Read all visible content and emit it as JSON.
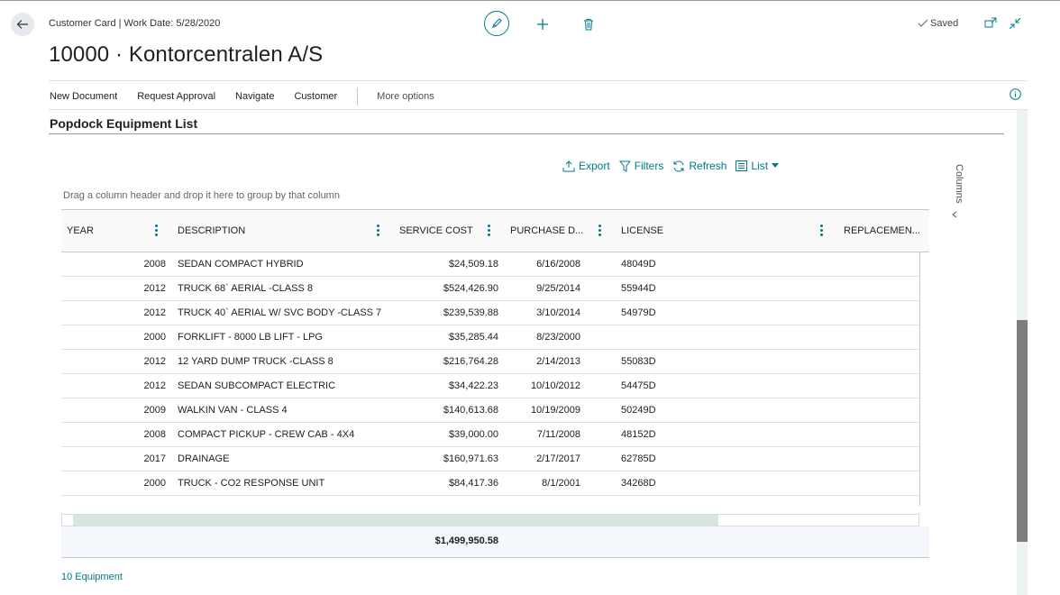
{
  "header": {
    "caption": "Customer Card | Work Date: 5/28/2020",
    "title": "10000 · Kontorcentralen A/S",
    "saved_label": "Saved",
    "icons": {
      "back": "arrow-left-icon",
      "edit": "pencil-icon",
      "new": "plus-icon",
      "delete": "trash-icon",
      "saved": "checkmark-icon",
      "popout": "popout-icon",
      "collapse": "collapse-icon"
    }
  },
  "actions": {
    "items": [
      "New Document",
      "Request Approval",
      "Navigate",
      "Customer"
    ],
    "more": "More options",
    "info_icon": "info-icon"
  },
  "part": {
    "title": "Popdock Equipment List",
    "toolbar": {
      "export": "Export",
      "filters": "Filters",
      "refresh": "Refresh",
      "view": "List"
    },
    "columns_label": "Columns",
    "group_hint": "Drag a column header and drop it here to group by that column",
    "headers": [
      "YEAR",
      "DESCRIPTION",
      "SERVICE COST",
      "PURCHASE D...",
      "LICENSE",
      "REPLACEMEN..."
    ],
    "rows": [
      {
        "year": "2008",
        "description": "SEDAN COMPACT HYBRID",
        "service_cost": "$24,509.18",
        "purchase_date": "6/16/2008",
        "license": "48049D"
      },
      {
        "year": "2012",
        "description": "TRUCK 68` AERIAL -CLASS 8",
        "service_cost": "$524,426.90",
        "purchase_date": "9/25/2014",
        "license": "55944D"
      },
      {
        "year": "2012",
        "description": "TRUCK 40` AERIAL W/ SVC BODY -CLASS 7",
        "service_cost": "$239,539.88",
        "purchase_date": "3/10/2014",
        "license": "54979D"
      },
      {
        "year": "2000",
        "description": "FORKLIFT - 8000 LB LIFT - LPG",
        "service_cost": "$35,285.44",
        "purchase_date": "8/23/2000",
        "license": ""
      },
      {
        "year": "2012",
        "description": "12 YARD DUMP TRUCK -CLASS 8",
        "service_cost": "$216,764.28",
        "purchase_date": "2/14/2013",
        "license": "55083D"
      },
      {
        "year": "2012",
        "description": "SEDAN SUBCOMPACT ELECTRIC",
        "service_cost": "$34,422.23",
        "purchase_date": "10/10/2012",
        "license": "54475D"
      },
      {
        "year": "2009",
        "description": "WALKIN VAN - CLASS 4",
        "service_cost": "$140,613.68",
        "purchase_date": "10/19/2009",
        "license": "50249D"
      },
      {
        "year": "2008",
        "description": "COMPACT PICKUP - CREW CAB - 4X4",
        "service_cost": "$39,000.00",
        "purchase_date": "7/11/2008",
        "license": "48152D"
      },
      {
        "year": "2017",
        "description": "DRAINAGE",
        "service_cost": "$160,971.63",
        "purchase_date": "2/17/2017",
        "license": "62785D"
      },
      {
        "year": "2000",
        "description": "TRUCK - CO2 RESPONSE UNIT",
        "service_cost": "$84,417.36",
        "purchase_date": "8/1/2001",
        "license": "34268D"
      }
    ],
    "total_service_cost": "$1,499,950.58",
    "count_label": "10 Equipment"
  },
  "colors": {
    "accent": "#00798a",
    "scroll_thumb": "#7e7e7e",
    "scroll_track": "#edf3f1",
    "totals_bg": "#f4f7fb"
  }
}
